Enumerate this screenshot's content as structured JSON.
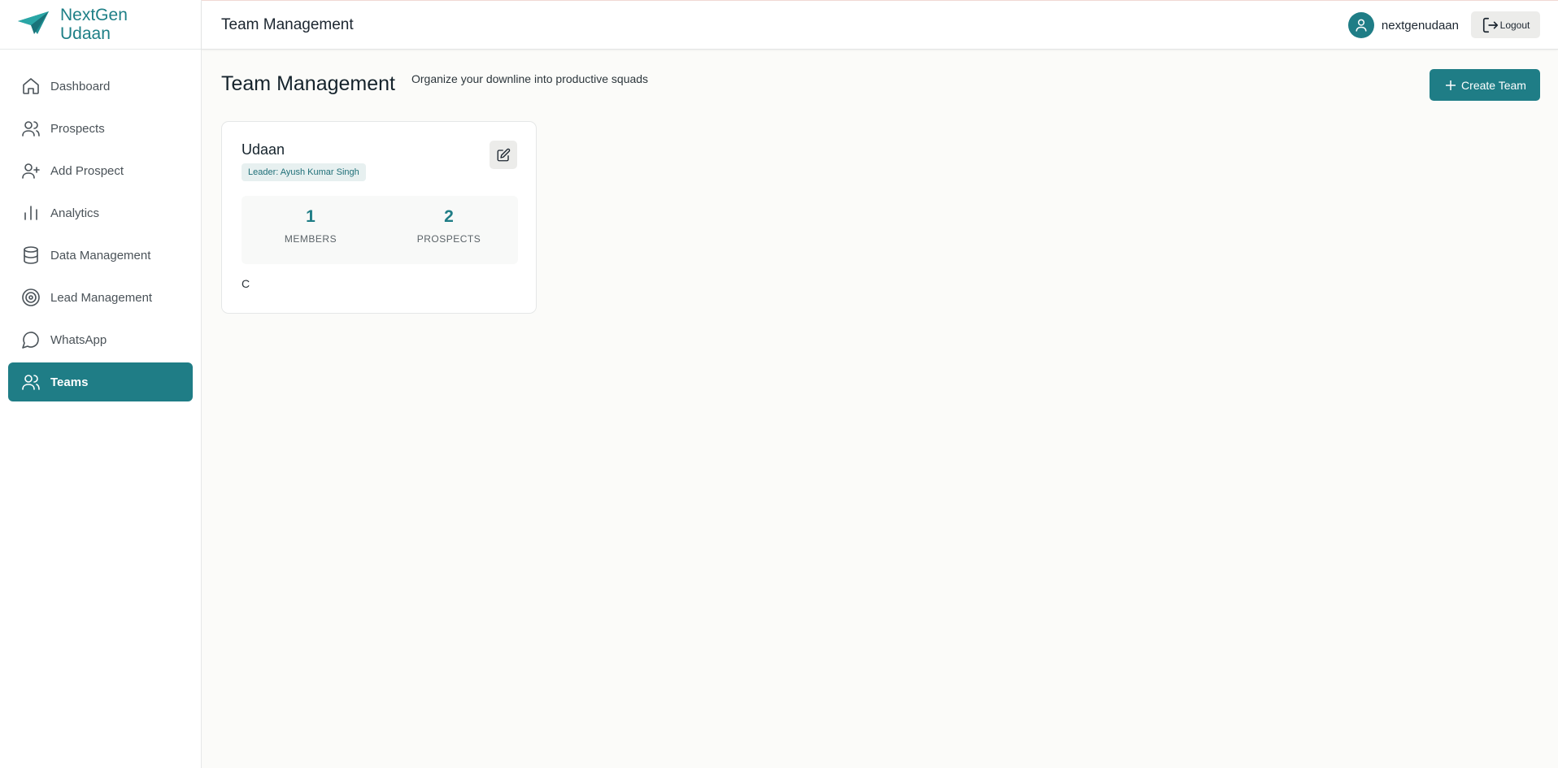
{
  "brand": {
    "name": "NextGen Udaan",
    "color": "#1d7f86"
  },
  "sidebar": {
    "items": [
      {
        "label": "Dashboard",
        "icon": "home-icon"
      },
      {
        "label": "Prospects",
        "icon": "users-icon"
      },
      {
        "label": "Add Prospect",
        "icon": "user-plus-icon"
      },
      {
        "label": "Analytics",
        "icon": "bar-chart-icon"
      },
      {
        "label": "Data Management",
        "icon": "database-icon"
      },
      {
        "label": "Lead Management",
        "icon": "target-icon"
      },
      {
        "label": "WhatsApp",
        "icon": "chat-bubble-icon"
      },
      {
        "label": "Teams",
        "icon": "users-icon",
        "active": true
      }
    ]
  },
  "header": {
    "title": "Team Management",
    "username": "nextgenudaan",
    "logout_label": "Logout"
  },
  "main": {
    "title": "Team Management",
    "subtitle": "Organize your downline into productive squads",
    "create_label": "Create Team"
  },
  "teams": [
    {
      "name": "Udaan",
      "leader": "Leader: Ayush Kumar Singh",
      "members": "1",
      "members_label": "MEMBERS",
      "prospects": "2",
      "prospects_label": "PROSPECTS",
      "footer": "C"
    }
  ],
  "colors": {
    "accent": "#1f7d86",
    "background": "#fbfbf9"
  }
}
